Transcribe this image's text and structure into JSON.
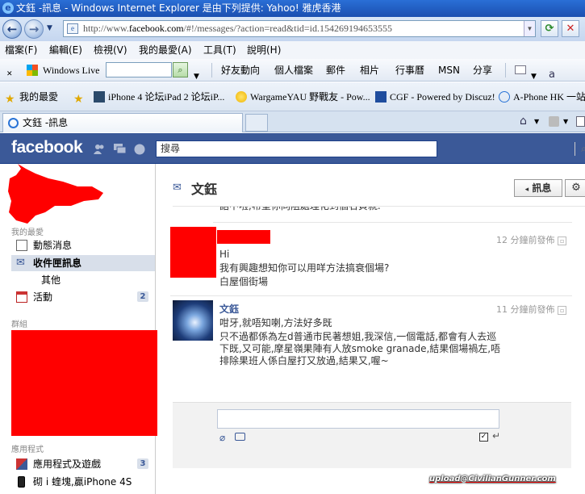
{
  "window": {
    "title": "文鈺 -訊息 - Windows Internet Explorer 是由下列提供: Yahoo! 雅虎香港"
  },
  "address_bar": {
    "url_prefix": "http://www.",
    "url_domain": "facebook.com",
    "url_suffix": "/#!/messages/?action=read&tid=id.154269194653555"
  },
  "menu": {
    "items": [
      "檔案(F)",
      "編輯(E)",
      "檢視(V)",
      "我的最愛(A)",
      "工具(T)",
      "說明(H)"
    ]
  },
  "toolbar": {
    "windows_live": "Windows Live",
    "links": [
      "好友動向",
      "個人檔案",
      "郵件",
      "相片",
      "行事曆",
      "MSN",
      "分享"
    ]
  },
  "favorites": {
    "label": "我的最愛",
    "items": [
      "iPhone 4 论坛iPad 2 论坛iP...",
      "WargameYAU 野戰友 - Pow...",
      "CGF - Powered by Discuz!",
      "A-Phone HK 一站"
    ]
  },
  "tab": {
    "title": "文鈺 -訊息"
  },
  "facebook": {
    "logo": "facebook",
    "search_placeholder": "搜尋",
    "sidebar": {
      "favorites_header": "我的最愛",
      "items": [
        {
          "label": "動態消息"
        },
        {
          "label": "收件匣訊息"
        },
        {
          "label": "其他"
        },
        {
          "label": "活動",
          "count": "2"
        }
      ],
      "groups_header": "群組",
      "apps_header": "應用程式",
      "apps": [
        {
          "label": "應用程式及遊戲",
          "count": "3"
        },
        {
          "label": "砌 i 蝰塊,贏iPhone 4S"
        }
      ]
    },
    "conversation": {
      "title": "文鈺",
      "back_button": "訊息",
      "clipped_text": "話中啦,希望你同阻處理化到個名負就.",
      "messages": [
        {
          "timestamp": "12 分鐘前發佈",
          "lines": [
            "Hi",
            "我有興趣想知你可以用咩方法搞衰個場?",
            "白屋個街場"
          ]
        },
        {
          "sender": "文鈺",
          "timestamp": "11 分鐘前發佈",
          "lines": [
            "咁牙,就唔知喇,方法好多既",
            "只不過都係為左d普通市民著想姐,我深信,一個電話,都會有人去巡",
            "下既,又可能,摩星嶺果陣有人放smoke granade,結果個場禍左,唔",
            "排除果班人係白屋打又放過,結果又,喔~"
          ]
        }
      ]
    }
  },
  "watermark": "upload@CivilianGunner.com"
}
